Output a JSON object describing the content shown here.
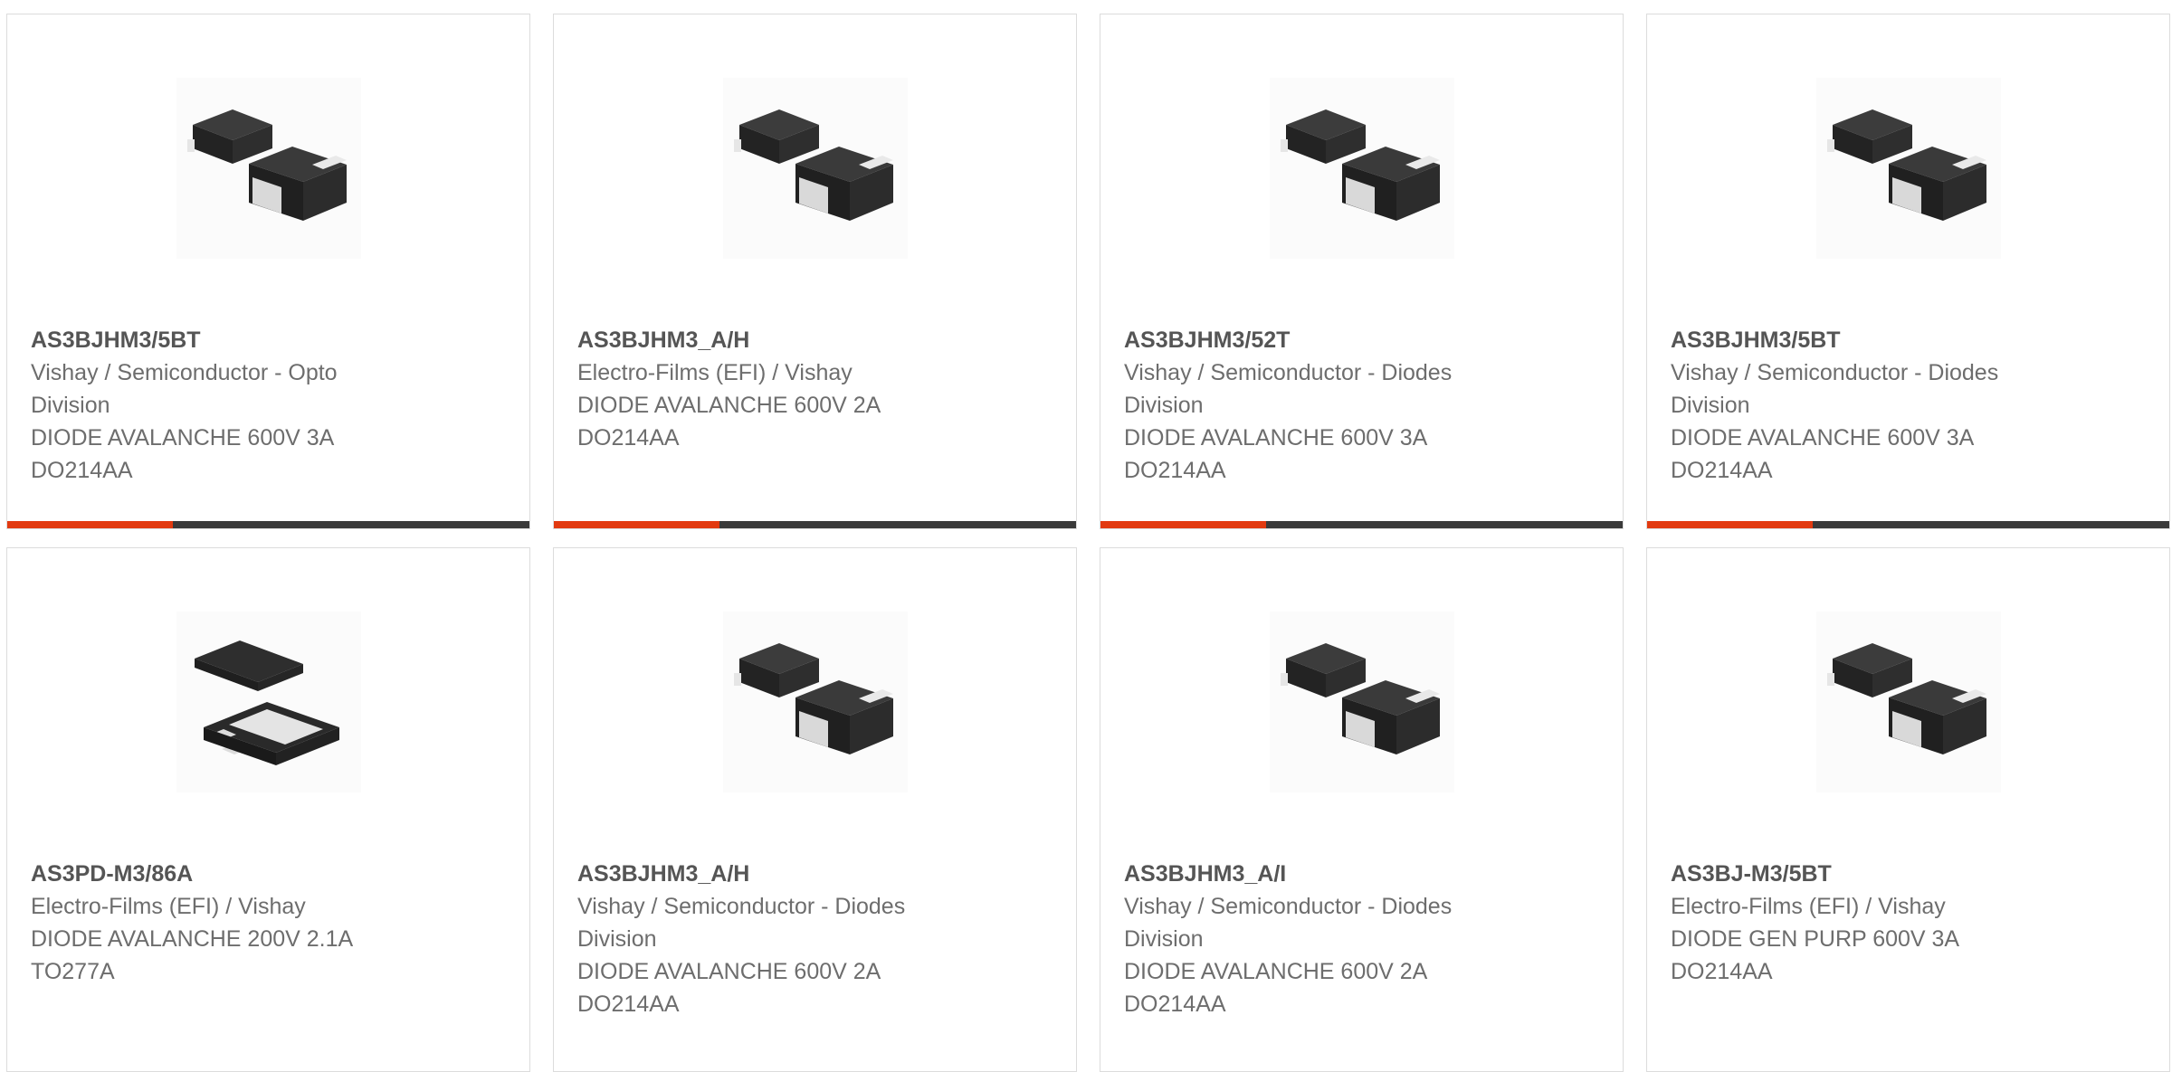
{
  "products": [
    {
      "part_number": "AS3BJHM3/5BT",
      "lines": [
        "Vishay / Semiconductor - Opto",
        "Division",
        "DIODE AVALANCHE 600V 3A",
        "DO214AA"
      ],
      "image_icon": "smb-diode-package-icon"
    },
    {
      "part_number": "AS3BJHM3_A/H",
      "lines": [
        "Electro-Films (EFI) / Vishay",
        "DIODE AVALANCHE 600V 2A",
        "DO214AA"
      ],
      "image_icon": "smb-diode-package-icon"
    },
    {
      "part_number": "AS3BJHM3/52T",
      "lines": [
        "Vishay / Semiconductor - Diodes",
        "Division",
        "DIODE AVALANCHE 600V 3A",
        "DO214AA"
      ],
      "image_icon": "smb-diode-package-icon"
    },
    {
      "part_number": "AS3BJHM3/5BT",
      "lines": [
        "Vishay / Semiconductor - Diodes",
        "Division",
        "DIODE AVALANCHE 600V 3A",
        "DO214AA"
      ],
      "image_icon": "smb-diode-package-icon"
    },
    {
      "part_number": "AS3PD-M3/86A",
      "lines": [
        "Electro-Films (EFI) / Vishay",
        "DIODE AVALANCHE 200V 2.1A",
        "TO277A"
      ],
      "image_icon": "to277a-package-icon"
    },
    {
      "part_number": "AS3BJHM3_A/H",
      "lines": [
        "Vishay / Semiconductor - Diodes",
        "Division",
        "DIODE AVALANCHE 600V 2A",
        "DO214AA"
      ],
      "image_icon": "smb-diode-package-icon"
    },
    {
      "part_number": "AS3BJHM3_A/I",
      "lines": [
        "Vishay / Semiconductor - Diodes",
        "Division",
        "DIODE AVALANCHE 600V 2A",
        "DO214AA"
      ],
      "image_icon": "smb-diode-package-icon"
    },
    {
      "part_number": "AS3BJ-M3/5BT",
      "lines": [
        "Electro-Films (EFI) / Vishay",
        "DIODE GEN PURP 600V 3A",
        "DO214AA"
      ],
      "image_icon": "smb-diode-package-icon"
    }
  ],
  "colors": {
    "accent": "#e23a10",
    "bar": "#3a3a3a",
    "border": "#dcdcdc"
  }
}
